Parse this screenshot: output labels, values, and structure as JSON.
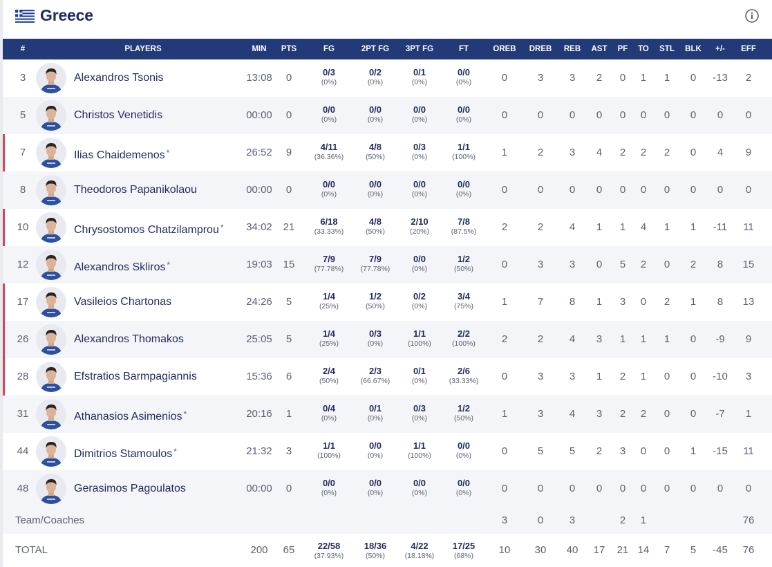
{
  "team": {
    "name": "Greece"
  },
  "colors": {
    "header_bg": "#233a78",
    "starter_marker": "#d2455a",
    "alt_row": "#f4f5f8",
    "title": "#1f2b5b"
  },
  "columns": [
    "#",
    "PLAYERS",
    "MIN",
    "PTS",
    "FG",
    "2PT FG",
    "3PT FG",
    "FT",
    "OREB",
    "DREB",
    "REB",
    "AST",
    "PF",
    "TO",
    "STL",
    "BLK",
    "+/-",
    "EFF"
  ],
  "players": [
    {
      "num": "3",
      "name": "Alexandros Tsonis",
      "star": "",
      "starter": false,
      "min": "13:08",
      "pts": "0",
      "fg": "0/3",
      "fg_pct": "(0%)",
      "fg2": "0/2",
      "fg2_pct": "(0%)",
      "fg3": "0/1",
      "fg3_pct": "(0%)",
      "ft": "0/0",
      "ft_pct": "(0%)",
      "oreb": "0",
      "dreb": "3",
      "reb": "3",
      "ast": "2",
      "pf": "0",
      "to": "1",
      "stl": "1",
      "blk": "0",
      "pm": "-13",
      "eff": "2"
    },
    {
      "num": "5",
      "name": "Christos Venetidis",
      "star": "",
      "starter": false,
      "min": "00:00",
      "pts": "0",
      "fg": "0/0",
      "fg_pct": "(0%)",
      "fg2": "0/0",
      "fg2_pct": "(0%)",
      "fg3": "0/0",
      "fg3_pct": "(0%)",
      "ft": "0/0",
      "ft_pct": "(0%)",
      "oreb": "0",
      "dreb": "0",
      "reb": "0",
      "ast": "0",
      "pf": "0",
      "to": "0",
      "stl": "0",
      "blk": "0",
      "pm": "0",
      "eff": "0"
    },
    {
      "num": "7",
      "name": "Ilias Chaidemenos",
      "star": "*",
      "starter": true,
      "min": "26:52",
      "pts": "9",
      "fg": "4/11",
      "fg_pct": "(36.36%)",
      "fg2": "4/8",
      "fg2_pct": "(50%)",
      "fg3": "0/3",
      "fg3_pct": "(0%)",
      "ft": "1/1",
      "ft_pct": "(100%)",
      "oreb": "1",
      "dreb": "2",
      "reb": "3",
      "ast": "4",
      "pf": "2",
      "to": "2",
      "stl": "2",
      "blk": "0",
      "pm": "4",
      "eff": "9"
    },
    {
      "num": "8",
      "name": "Theodoros Papanikolaou",
      "star": "",
      "starter": false,
      "min": "00:00",
      "pts": "0",
      "fg": "0/0",
      "fg_pct": "(0%)",
      "fg2": "0/0",
      "fg2_pct": "(0%)",
      "fg3": "0/0",
      "fg3_pct": "(0%)",
      "ft": "0/0",
      "ft_pct": "(0%)",
      "oreb": "0",
      "dreb": "0",
      "reb": "0",
      "ast": "0",
      "pf": "0",
      "to": "0",
      "stl": "0",
      "blk": "0",
      "pm": "0",
      "eff": "0"
    },
    {
      "num": "10",
      "name": "Chrysostomos Chatzilamprou",
      "star": "*",
      "starter": true,
      "min": "34:02",
      "pts": "21",
      "fg": "6/18",
      "fg_pct": "(33.33%)",
      "fg2": "4/8",
      "fg2_pct": "(50%)",
      "fg3": "2/10",
      "fg3_pct": "(20%)",
      "ft": "7/8",
      "ft_pct": "(87.5%)",
      "oreb": "2",
      "dreb": "2",
      "reb": "4",
      "ast": "1",
      "pf": "1",
      "to": "4",
      "stl": "1",
      "blk": "1",
      "pm": "-11",
      "eff": "11"
    },
    {
      "num": "12",
      "name": "Alexandros Skliros",
      "star": "*",
      "starter": false,
      "min": "19:03",
      "pts": "15",
      "fg": "7/9",
      "fg_pct": "(77.78%)",
      "fg2": "7/9",
      "fg2_pct": "(77.78%)",
      "fg3": "0/0",
      "fg3_pct": "(0%)",
      "ft": "1/2",
      "ft_pct": "(50%)",
      "oreb": "0",
      "dreb": "3",
      "reb": "3",
      "ast": "0",
      "pf": "5",
      "to": "2",
      "stl": "0",
      "blk": "2",
      "pm": "8",
      "eff": "15"
    },
    {
      "num": "17",
      "name": "Vasileios Chartonas",
      "star": "",
      "starter": true,
      "min": "24:26",
      "pts": "5",
      "fg": "1/4",
      "fg_pct": "(25%)",
      "fg2": "1/2",
      "fg2_pct": "(50%)",
      "fg3": "0/2",
      "fg3_pct": "(0%)",
      "ft": "3/4",
      "ft_pct": "(75%)",
      "oreb": "1",
      "dreb": "7",
      "reb": "8",
      "ast": "1",
      "pf": "3",
      "to": "0",
      "stl": "2",
      "blk": "1",
      "pm": "8",
      "eff": "13"
    },
    {
      "num": "26",
      "name": "Alexandros Thomakos",
      "star": "",
      "starter": true,
      "min": "25:05",
      "pts": "5",
      "fg": "1/4",
      "fg_pct": "(25%)",
      "fg2": "0/3",
      "fg2_pct": "(0%)",
      "fg3": "1/1",
      "fg3_pct": "(100%)",
      "ft": "2/2",
      "ft_pct": "(100%)",
      "oreb": "2",
      "dreb": "2",
      "reb": "4",
      "ast": "3",
      "pf": "1",
      "to": "1",
      "stl": "1",
      "blk": "0",
      "pm": "-9",
      "eff": "9"
    },
    {
      "num": "28",
      "name": "Efstratios Barmpagiannis",
      "star": "",
      "starter": true,
      "min": "15:36",
      "pts": "6",
      "fg": "2/4",
      "fg_pct": "(50%)",
      "fg2": "2/3",
      "fg2_pct": "(66.67%)",
      "fg3": "0/1",
      "fg3_pct": "(0%)",
      "ft": "2/6",
      "ft_pct": "(33.33%)",
      "oreb": "0",
      "dreb": "3",
      "reb": "3",
      "ast": "1",
      "pf": "2",
      "to": "1",
      "stl": "0",
      "blk": "0",
      "pm": "-10",
      "eff": "3"
    },
    {
      "num": "31",
      "name": "Athanasios Asimenios",
      "star": "*",
      "starter": false,
      "min": "20:16",
      "pts": "1",
      "fg": "0/4",
      "fg_pct": "(0%)",
      "fg2": "0/1",
      "fg2_pct": "(0%)",
      "fg3": "0/3",
      "fg3_pct": "(0%)",
      "ft": "1/2",
      "ft_pct": "(50%)",
      "oreb": "1",
      "dreb": "3",
      "reb": "4",
      "ast": "3",
      "pf": "2",
      "to": "2",
      "stl": "0",
      "blk": "0",
      "pm": "-7",
      "eff": "1"
    },
    {
      "num": "44",
      "name": "Dimitrios Stamoulos",
      "star": "*",
      "starter": false,
      "min": "21:32",
      "pts": "3",
      "fg": "1/1",
      "fg_pct": "(100%)",
      "fg2": "0/0",
      "fg2_pct": "(0%)",
      "fg3": "1/1",
      "fg3_pct": "(100%)",
      "ft": "0/0",
      "ft_pct": "(0%)",
      "oreb": "0",
      "dreb": "5",
      "reb": "5",
      "ast": "2",
      "pf": "3",
      "to": "0",
      "stl": "0",
      "blk": "1",
      "pm": "-15",
      "eff": "11"
    },
    {
      "num": "48",
      "name": "Gerasimos Pagoulatos",
      "star": "",
      "starter": false,
      "min": "00:00",
      "pts": "0",
      "fg": "0/0",
      "fg_pct": "(0%)",
      "fg2": "0/0",
      "fg2_pct": "(0%)",
      "fg3": "0/0",
      "fg3_pct": "(0%)",
      "ft": "0/0",
      "ft_pct": "(0%)",
      "oreb": "0",
      "dreb": "0",
      "reb": "0",
      "ast": "0",
      "pf": "0",
      "to": "0",
      "stl": "0",
      "blk": "0",
      "pm": "0",
      "eff": "0"
    }
  ],
  "team_coaches": {
    "label": "Team/Coaches",
    "oreb": "3",
    "dreb": "0",
    "reb": "3",
    "pf": "2",
    "to": "1",
    "eff": "76"
  },
  "total": {
    "label": "TOTAL",
    "min": "200",
    "pts": "65",
    "fg": "22/58",
    "fg_pct": "(37.93%)",
    "fg2": "18/36",
    "fg2_pct": "(50%)",
    "fg3": "4/22",
    "fg3_pct": "(18.18%)",
    "ft": "17/25",
    "ft_pct": "(68%)",
    "oreb": "10",
    "dreb": "30",
    "reb": "40",
    "ast": "17",
    "pf": "21",
    "to": "14",
    "stl": "7",
    "blk": "5",
    "pm": "-45",
    "eff": "76"
  }
}
